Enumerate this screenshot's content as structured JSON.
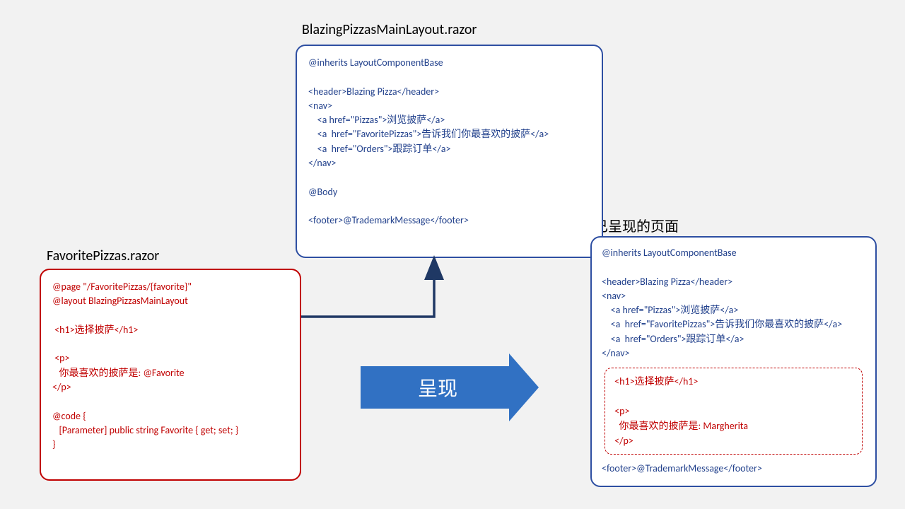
{
  "labels": {
    "layout_file": "BlazingPizzasMainLayout.razor",
    "favorite_file": "FavoritePizzas.razor",
    "rendered_title": "已呈现的页面",
    "render_arrow": "呈现"
  },
  "layout_code": "@inherits LayoutComponentBase\n\n<header>Blazing Pizza</header>\n<nav>\n    <a href=\"Pizzas\">浏览披萨</a>\n    <a  href=\"FavoritePizzas\">告诉我们你最喜欢的披萨</a>\n    <a  href=\"Orders\">跟踪订单</a>\n</nav>\n\n@Body\n\n<footer>@TrademarkMessage</footer>",
  "favorite_code": "@page \"/FavoritePizzas/{favorite}\"\n@layout BlazingPizzasMainLayout\n\n <h1>选择披萨</h1>\n\n <p>\n   你最喜欢的披萨是: @Favorite\n</p>\n\n@code {\n   [Parameter] public string Favorite { get; set; }\n}",
  "rendered_top": "@inherits LayoutComponentBase\n\n<header>Blazing Pizza</header>\n<nav>\n    <a href=\"Pizzas\">浏览披萨</a>\n    <a  href=\"FavoritePizzas\">告诉我们你最喜欢的披萨</a>\n    <a  href=\"Orders\">跟踪订单</a>\n</nav>",
  "rendered_body": " <h1>选择披萨</h1>\n\n <p>\n   你最喜欢的披萨是: Margherita\n </p>",
  "rendered_footer": "<footer>@TrademarkMessage</footer>"
}
